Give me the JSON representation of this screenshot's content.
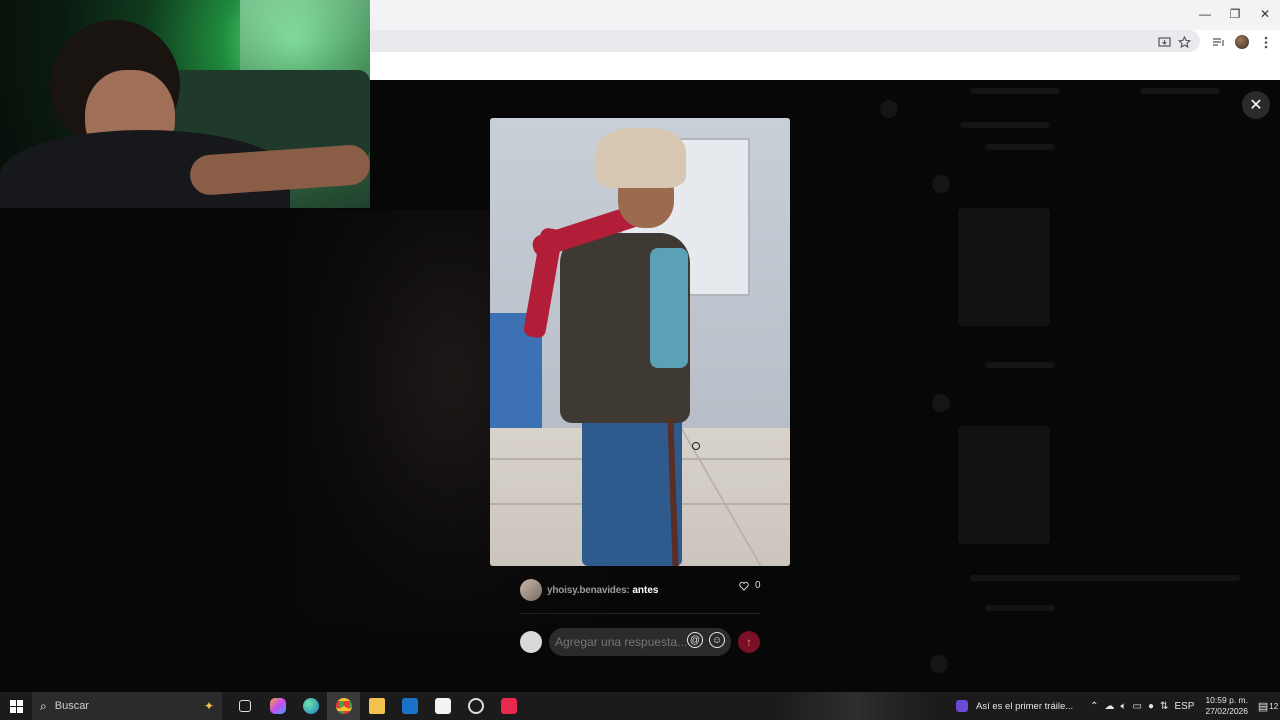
{
  "browser": {
    "window_controls": {
      "minimize": "—",
      "restore": "❐",
      "close": "✕"
    },
    "toolbar_icons": [
      "install-app-icon",
      "bookmark-star-icon",
      "media-controls-icon",
      "profile-avatar",
      "menu-kebab-icon"
    ]
  },
  "modal": {
    "close_label": "✕",
    "comment": {
      "username": "yhoisy.benavides:",
      "text": "antes",
      "likes": "0"
    },
    "reply": {
      "placeholder": "Agregar una respuesta...",
      "mention_icon": "@",
      "emoji_icon": "☺",
      "send_icon": "↑"
    }
  },
  "taskbar": {
    "search_placeholder": "Buscar",
    "apps": [
      "task-view-icon",
      "copilot-icon",
      "edge-icon",
      "chrome-icon",
      "file-explorer-icon",
      "outlook-icon",
      "store-icon",
      "obs-icon",
      "tiktok-icon"
    ],
    "now_playing": "Así es el primer tráile...",
    "language": "ESP",
    "time": "10:59 p. m.",
    "date": "27/02/2026",
    "notification_count": "12"
  },
  "colors": {
    "send_button": "#7a1026",
    "taskbar": "#1b1b1b",
    "backdrop": "#070707"
  }
}
